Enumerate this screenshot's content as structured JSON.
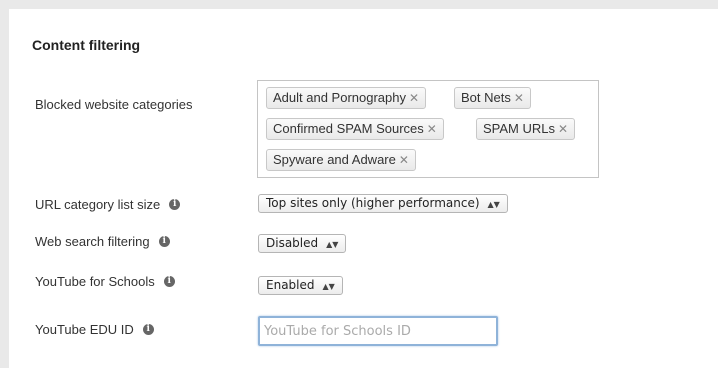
{
  "section": {
    "title": "Content filtering"
  },
  "blocked_categories": {
    "label": "Blocked website categories",
    "tags": [
      "Adult and Pornography",
      "Bot Nets",
      "Confirmed SPAM Sources",
      "SPAM URLs",
      "Spyware and Adware"
    ],
    "remove_glyph": "✕"
  },
  "url_list_size": {
    "label": "URL category list size",
    "selected": "Top sites only (higher performance)"
  },
  "web_search": {
    "label": "Web search filtering",
    "selected": "Disabled"
  },
  "youtube_schools": {
    "label": "YouTube for Schools",
    "selected": "Enabled"
  },
  "youtube_edu": {
    "label": "YouTube EDU ID",
    "value": "",
    "placeholder": "YouTube for Schools ID"
  },
  "icons": {
    "info": "info-icon",
    "select_arrow": "up-down-arrows-icon",
    "remove": "close-icon"
  }
}
